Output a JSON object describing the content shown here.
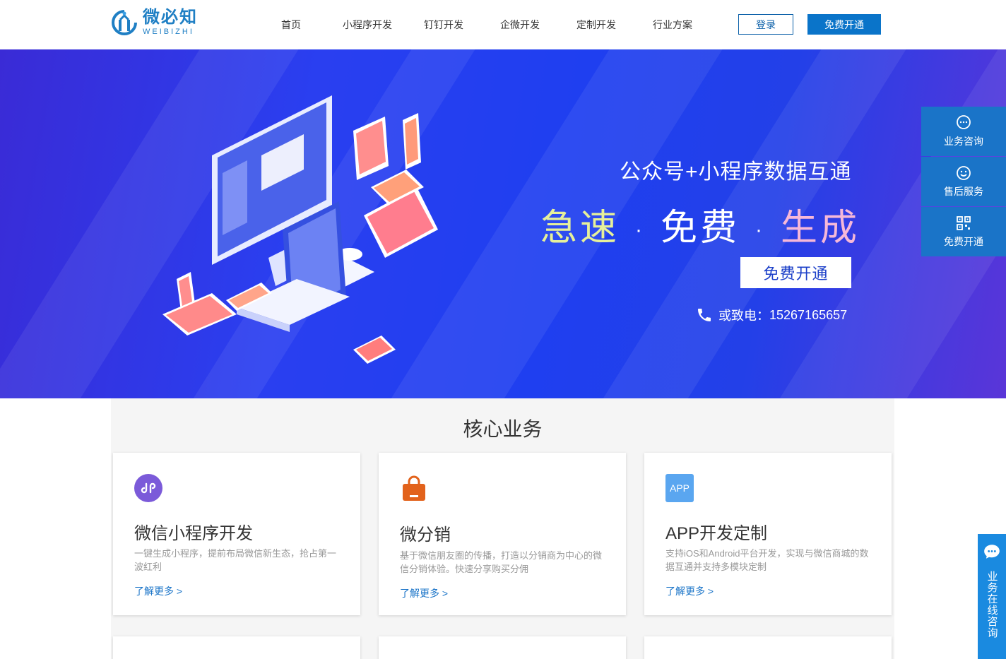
{
  "brand": {
    "name_cn": "微必知",
    "name_en": "WEIBIZHI",
    "color": "#1f7fc4"
  },
  "nav": {
    "items": [
      {
        "label": "首页"
      },
      {
        "label": "小程序开发"
      },
      {
        "label": "钉钉开发"
      },
      {
        "label": "企微开发"
      },
      {
        "label": "定制开发"
      },
      {
        "label": "行业方案"
      }
    ],
    "login": "登录",
    "free_open": "免费开通"
  },
  "banner": {
    "subtitle": "公众号+小程序数据互通",
    "slogan": [
      "急速",
      "免费",
      "生成"
    ],
    "separator": "·",
    "button": "免费开通",
    "phone_label": "或致电：",
    "phone": "15267165657"
  },
  "side": {
    "items": [
      {
        "label": "业务咨询",
        "icon": "chat-icon"
      },
      {
        "label": "售后服务",
        "icon": "smile-icon"
      },
      {
        "label": "免费开通",
        "icon": "qrcode-icon"
      }
    ],
    "float_chat": "业务在线咨询"
  },
  "core": {
    "title": "核心业务",
    "cards": [
      {
        "icon": "mini-program-icon",
        "title": "微信小程序开发",
        "desc": "一键生成小程序，提前布局微信新生态，抢占第一波红利",
        "more": "了解更多 >"
      },
      {
        "icon": "shopping-bag-icon",
        "title": "微分销",
        "desc": "基于微信朋友圈的传播，打造以分销商为中心的微信分销体验。快速分享购买分佣",
        "more": "了解更多 >"
      },
      {
        "icon": "app-icon",
        "title": "APP开发定制",
        "desc": "支持iOS和Android平台开发，实现与微信商城的数据互通并支持多模块定制",
        "more": "了解更多 >",
        "icon_text": "APP"
      }
    ]
  },
  "colors": {
    "primary": "#1a74c8",
    "banner": "#2a3ff0"
  }
}
